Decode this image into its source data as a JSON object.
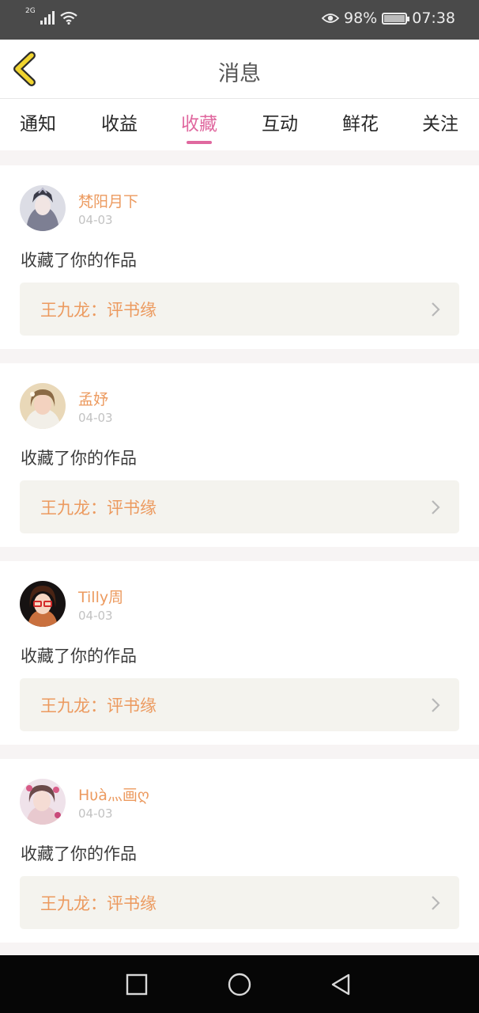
{
  "status_bar": {
    "network": "2G",
    "battery": "98%",
    "time": "07:38",
    "icons": [
      "signal-icon",
      "wifi-icon",
      "eye-icon",
      "battery-icon"
    ]
  },
  "header": {
    "title": "消息",
    "back_icon": "chevron-left-icon"
  },
  "tabs": [
    {
      "label": "通知"
    },
    {
      "label": "收益"
    },
    {
      "label": "收藏",
      "active": true
    },
    {
      "label": "互动"
    },
    {
      "label": "鲜花"
    },
    {
      "label": "关注"
    }
  ],
  "messages": [
    {
      "user": "梵阳月下",
      "date": "04-03",
      "action": "收藏了你的作品",
      "work": "王九龙：评书缘"
    },
    {
      "user": "孟妤",
      "date": "04-03",
      "action": "收藏了你的作品",
      "work": "王九龙：评书缘"
    },
    {
      "user": "Tilly周",
      "date": "04-03",
      "action": "收藏了你的作品",
      "work": "王九龙：评书缘"
    },
    {
      "user": "Hυà灬画ღ",
      "date": "04-03",
      "action": "收藏了你的作品",
      "work": "王九龙：评书缘"
    }
  ],
  "nav_bar": {
    "buttons": [
      "recent-apps-icon",
      "home-icon",
      "back-triangle-icon"
    ]
  },
  "colors": {
    "accent": "#e0689f",
    "username": "#ec9a5f",
    "status_bar": "#4a4a4a",
    "nav_bar": "#060606",
    "back_icon": "#f0d430"
  }
}
